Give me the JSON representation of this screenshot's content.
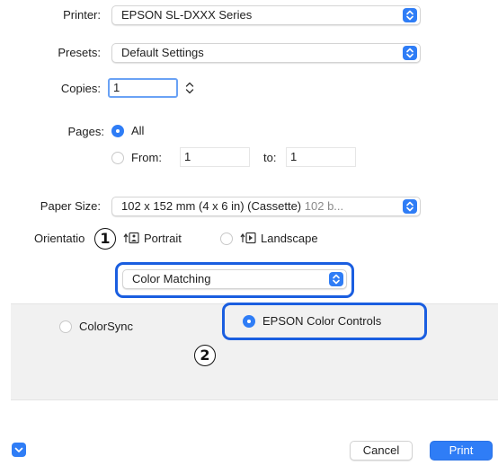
{
  "printer": {
    "label": "Printer:",
    "value": "EPSON SL-DXXX Series"
  },
  "presets": {
    "label": "Presets:",
    "value": "Default Settings"
  },
  "copies": {
    "label": "Copies:",
    "value": "1"
  },
  "pages": {
    "label": "Pages:",
    "all_label": "All",
    "from_label": "From:",
    "from_value": "1",
    "to_label": "to:",
    "to_value": "1",
    "selected": "All"
  },
  "paper_size": {
    "label": "Paper Size:",
    "value": "102 x 152 mm (4 x 6 in) (Cassette)",
    "secondary": "102 b..."
  },
  "orientation": {
    "label": "Orientatio",
    "portrait_label": "Portrait",
    "landscape_label": "Landscape",
    "selected": "Portrait"
  },
  "panel_popup": {
    "value": "Color Matching"
  },
  "color_options": {
    "colorsync_label": "ColorSync",
    "epson_label": "EPSON Color Controls",
    "selected": "EPSON Color Controls"
  },
  "callouts": {
    "one": "1",
    "two": "2"
  },
  "footer": {
    "cancel_label": "Cancel",
    "print_label": "Print"
  },
  "colors": {
    "accent": "#2f7df6",
    "highlight": "#1a5ee0",
    "panel_bg": "#f1f1f1"
  },
  "icons": {
    "popup_arrows": "updown-chevrons-icon",
    "copies_stepper": "stepper-icon",
    "portrait": "portrait-orientation-icon",
    "landscape": "landscape-orientation-icon",
    "details": "chevron-down-icon"
  }
}
